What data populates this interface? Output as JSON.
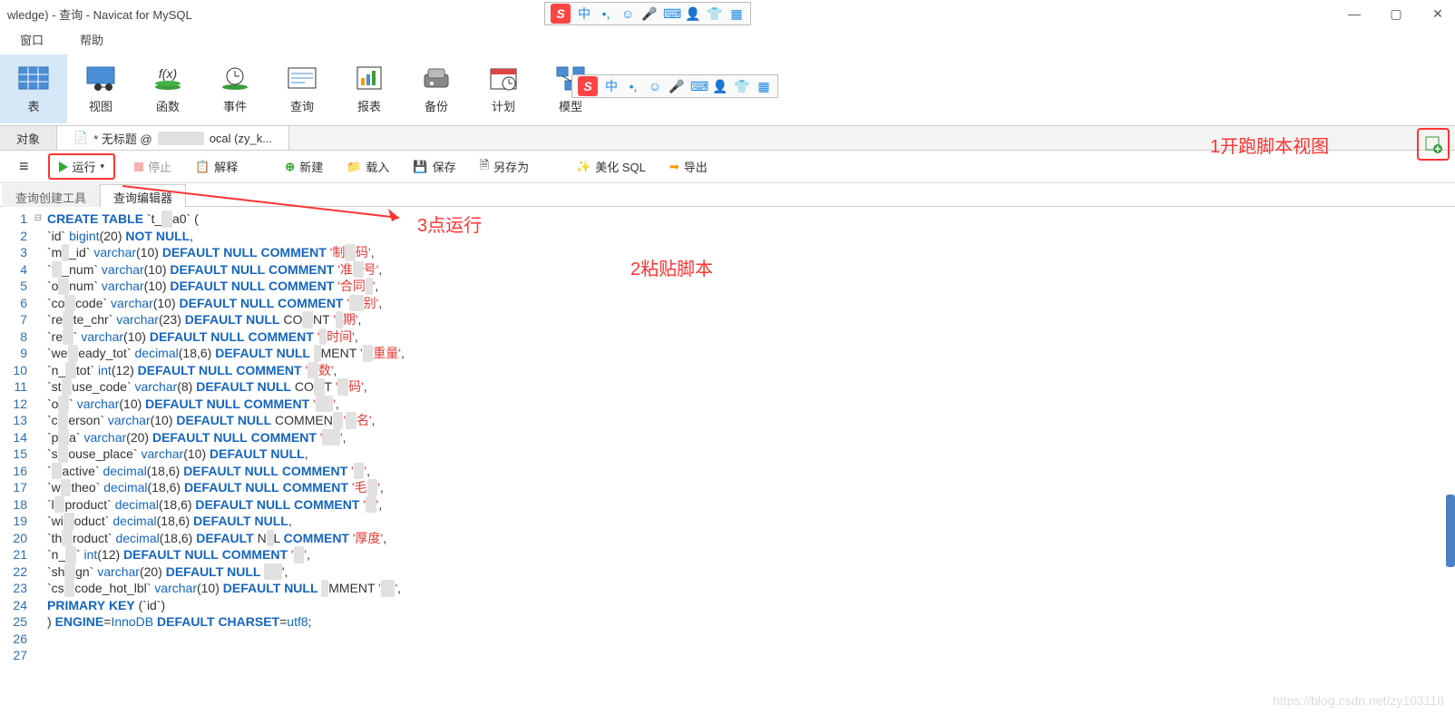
{
  "title": "wledge) - 查询 - Navicat for MySQL",
  "menubar": [
    "窗口",
    "帮助"
  ],
  "ime": {
    "glyphs": [
      "中",
      "•,",
      "☺",
      "🎤",
      "⌨",
      "👤",
      "👕",
      "▦"
    ]
  },
  "ribbon": [
    {
      "label": "表",
      "icon": "table",
      "active": true
    },
    {
      "label": "视图",
      "icon": "view"
    },
    {
      "label": "函数",
      "icon": "fx"
    },
    {
      "label": "事件",
      "icon": "event"
    },
    {
      "label": "查询",
      "icon": "query"
    },
    {
      "label": "报表",
      "icon": "report"
    },
    {
      "label": "备份",
      "icon": "backup"
    },
    {
      "label": "计划",
      "icon": "schedule"
    },
    {
      "label": "模型",
      "icon": "model"
    }
  ],
  "doctabs": {
    "object": "对象",
    "active_prefix": "* 无标题 @",
    "active_suffix": "ocal (zy_k..."
  },
  "qtoolbar": {
    "menu": "≡",
    "run": "运行",
    "stop": "停止",
    "explain": "解释",
    "new": "新建",
    "load": "载入",
    "save": "保存",
    "saveas": "另存为",
    "beautify": "美化 SQL",
    "export": "导出"
  },
  "subtabs": {
    "builder": "查询创建工具",
    "editor": "查询编辑器"
  },
  "annotations": {
    "a1": "1开跑脚本视图",
    "a2": "2粘贴脚本",
    "a3": "3点运行",
    "watermark": "https://blog.csdn.net/zy103118"
  },
  "lines": [
    {
      "n": 1,
      "raw": "CREATE TABLE `t_███a0` ("
    },
    {
      "n": 2,
      "raw": "  `id` bigint(20) NOT NULL,"
    },
    {
      "n": 3,
      "raw": "  `m██_id` varchar(10) DEFAULT NULL COMMENT '制███码',"
    },
    {
      "n": 4,
      "raw": "  `███_num` varchar(10) DEFAULT NULL COMMENT '准███号',"
    },
    {
      "n": 5,
      "raw": "  `o███num` varchar(10) DEFAULT NULL COMMENT '合同██',"
    },
    {
      "n": 6,
      "raw": "  `co███code` varchar(10) DEFAULT NULL COMMENT '████别',"
    },
    {
      "n": 7,
      "raw": "  `re███te_chr` varchar(23) DEFAULT NULL CO███NT '██期',"
    },
    {
      "n": 8,
      "raw": "  `re███` varchar(10) DEFAULT NULL COMMENT '██时间',"
    },
    {
      "n": 9,
      "raw": "  `we███eady_tot` decimal(18,6) DEFAULT NULL ██MENT '███重量',"
    },
    {
      "n": 10,
      "raw": "  `n_███tot` int(12) DEFAULT NULL COMMENT '███数',"
    },
    {
      "n": 11,
      "raw": "  `st███use_code` varchar(8) DEFAULT NULL CO███T '███码',"
    },
    {
      "n": 12,
      "raw": "  `o███` varchar(10) DEFAULT NULL COMMENT '█████',"
    },
    {
      "n": 13,
      "raw": "  `c███erson` varchar(10) DEFAULT NULL COMMEN███'███名',"
    },
    {
      "n": 14,
      "raw": "  `p███a` varchar(20) DEFAULT NULL COMMENT '█████',"
    },
    {
      "n": 15,
      "raw": "  `s███ouse_place` varchar(10) DEFAULT NULL,"
    },
    {
      "n": 16,
      "raw": "  `███active` decimal(18,6) DEFAULT NULL COMMENT '███',"
    },
    {
      "n": 17,
      "raw": "  `w███theo` decimal(18,6) DEFAULT NULL COMMENT '毛███',"
    },
    {
      "n": 18,
      "raw": "  `l███product` decimal(18,6) DEFAULT NULL COMMENT '███',"
    },
    {
      "n": 19,
      "raw": "  `wi███oduct` decimal(18,6) DEFAULT NULL,"
    },
    {
      "n": 20,
      "raw": "  `th███roduct` decimal(18,6) DEFAULT N██L COMMENT '厚度',"
    },
    {
      "n": 21,
      "raw": "  `n_███` int(12) DEFAULT NULL COMMENT '███',"
    },
    {
      "n": 22,
      "raw": "  `sh███gn` varchar(20) DEFAULT NULL █████',"
    },
    {
      "n": 23,
      "raw": "  `cs███code_hot_lbl` varchar(10) DEFAULT NULL ██MMENT '████',"
    },
    {
      "n": 24,
      "raw": "  PRIMARY KEY (`id`)"
    },
    {
      "n": 25,
      "raw": ") ENGINE=InnoDB DEFAULT CHARSET=utf8;"
    },
    {
      "n": 26,
      "raw": ""
    },
    {
      "n": 27,
      "raw": ""
    }
  ]
}
